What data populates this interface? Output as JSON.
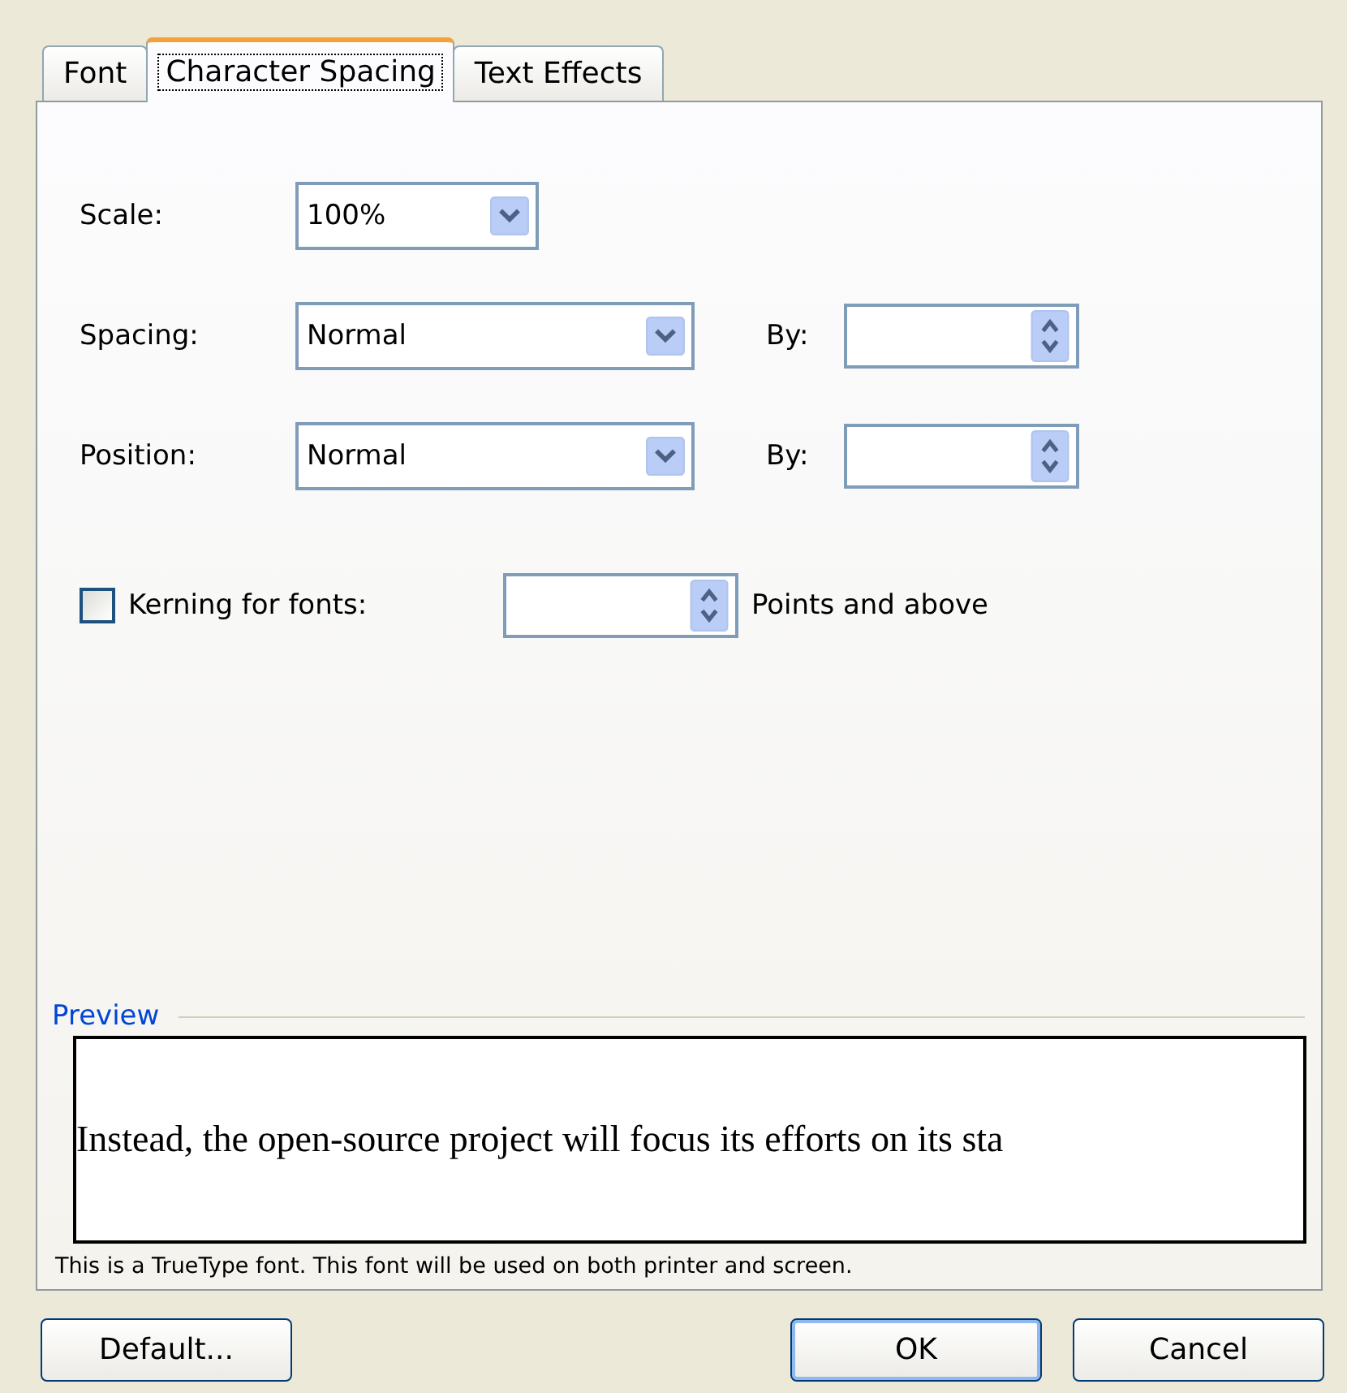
{
  "tabs": [
    {
      "label": "Font",
      "selected": false
    },
    {
      "label": "Character Spacing",
      "selected": true
    },
    {
      "label": "Text Effects",
      "selected": false
    }
  ],
  "rows": [
    {
      "kind": "combo",
      "label": "Scale:",
      "value": "100%"
    },
    {
      "kind": "combo-spin",
      "label": "Spacing:",
      "value": "Normal",
      "by_label": "By:"
    },
    {
      "kind": "combo-spin",
      "label": "Position:",
      "value": "Normal",
      "by_label": "By:"
    }
  ],
  "kerning": {
    "label": "Kerning for fonts:",
    "checked": false,
    "suffix": "Points and above"
  },
  "preview": {
    "legend": "Preview",
    "text": "Instead, the open-source project will focus its efforts on its sta"
  },
  "note": "This is a TrueType font. This font will be used on both printer and screen.",
  "buttons": [
    {
      "label": "Default...",
      "default": false
    },
    {
      "label": "OK",
      "default": true
    },
    {
      "label": "Cancel",
      "default": false
    }
  ]
}
